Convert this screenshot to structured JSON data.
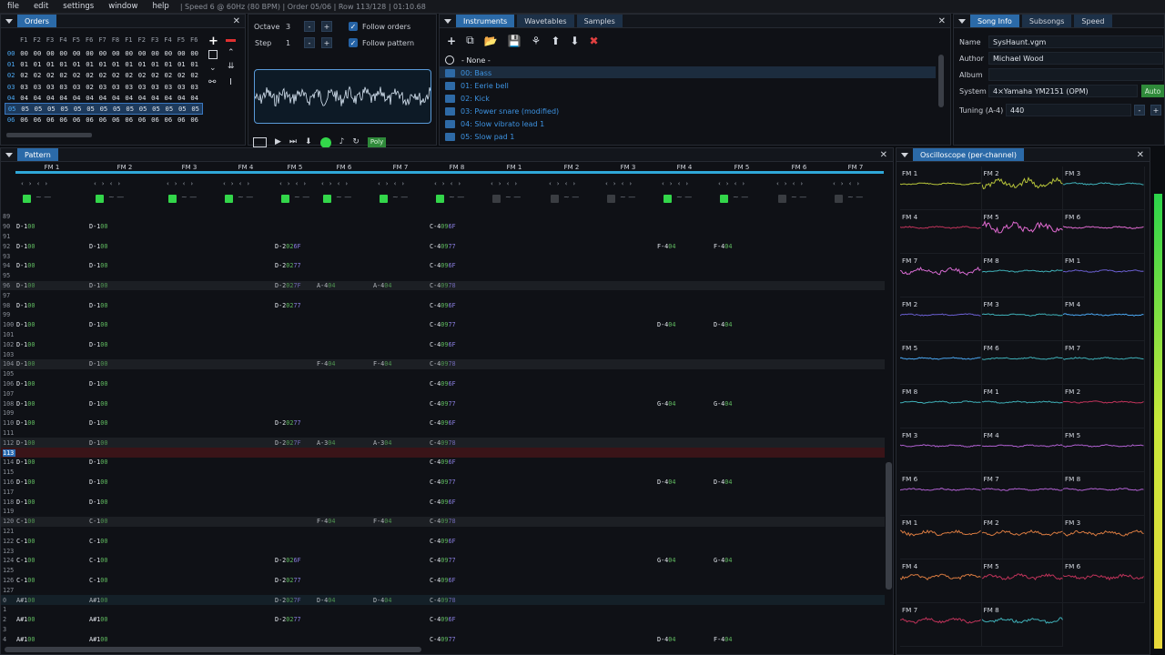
{
  "menubar": {
    "items": [
      "file",
      "edit",
      "settings",
      "window",
      "help"
    ],
    "status": "| Speed 6 @ 60Hz (80 BPM) | Order 05/06 | Row 113/128 | 01:10.68"
  },
  "orders": {
    "tab": "Orders",
    "headers": [
      "F1",
      "F2",
      "F3",
      "F4",
      "F5",
      "F6",
      "F7",
      "F8",
      "F1",
      "F2",
      "F3",
      "F4",
      "F5",
      "F6"
    ],
    "rows": [
      [
        "00",
        "00",
        "00",
        "00",
        "00",
        "00",
        "00",
        "00",
        "00",
        "00",
        "00",
        "00",
        "00",
        "00",
        "00"
      ],
      [
        "01",
        "01",
        "01",
        "01",
        "01",
        "01",
        "01",
        "01",
        "01",
        "01",
        "01",
        "01",
        "01",
        "01",
        "01"
      ],
      [
        "02",
        "02",
        "02",
        "02",
        "02",
        "02",
        "02",
        "02",
        "02",
        "02",
        "02",
        "02",
        "02",
        "02",
        "02"
      ],
      [
        "03",
        "03",
        "03",
        "03",
        "03",
        "03",
        "02",
        "03",
        "03",
        "03",
        "03",
        "03",
        "03",
        "03",
        "03"
      ],
      [
        "04",
        "04",
        "04",
        "04",
        "04",
        "04",
        "04",
        "04",
        "04",
        "04",
        "04",
        "04",
        "04",
        "04",
        "04"
      ],
      [
        "05",
        "05",
        "05",
        "05",
        "05",
        "05",
        "05",
        "05",
        "05",
        "05",
        "05",
        "05",
        "05",
        "05",
        "05"
      ],
      [
        "06",
        "06",
        "06",
        "06",
        "06",
        "06",
        "06",
        "06",
        "06",
        "06",
        "06",
        "06",
        "06",
        "06",
        "06"
      ]
    ]
  },
  "controls": {
    "octave_label": "Octave",
    "octave": "3",
    "step_label": "Step",
    "step": "1",
    "follow_orders": "Follow orders",
    "follow_pattern": "Follow pattern",
    "poly": "Poly",
    "minus": "-",
    "plus": "+"
  },
  "instruments": {
    "tabs": [
      "Instruments",
      "Wavetables",
      "Samples"
    ],
    "none": "- None -",
    "items": [
      "00: Bass",
      "01: Eerie bell",
      "02: Kick",
      "03: Power snare (modified)",
      "04: Slow vibrato lead 1",
      "05: Slow pad 1"
    ]
  },
  "song": {
    "tabs": [
      "Song Info",
      "Subsongs",
      "Speed"
    ],
    "name_label": "Name",
    "name": "SysHaunt.vgm",
    "author_label": "Author",
    "author": "Michael Wood",
    "album_label": "Album",
    "album": "",
    "system_label": "System",
    "system": "4×Yamaha YM2151 (OPM)",
    "auto": "Auto",
    "tuning_label": "Tuning (A-4)",
    "tuning": "440",
    "minus": "-",
    "plus": "+"
  },
  "pattern": {
    "tab": "Pattern",
    "channels": [
      "FM 1",
      "FM 2",
      "FM 3",
      "FM 4",
      "FM 5",
      "FM 6",
      "FM 7",
      "FM 8",
      "FM 1",
      "FM 2",
      "FM 3",
      "FM 4",
      "FM 5",
      "FM 6",
      "FM 7"
    ],
    "rows": [
      {
        "n": "89",
        "c": []
      },
      {
        "n": "90",
        "c": [
          [
            "D-1",
            "00",
            ""
          ],
          [
            "D-1",
            "00",
            ""
          ],
          null,
          null,
          null,
          null,
          null,
          [
            "C-4",
            "09",
            "6F"
          ]
        ]
      },
      {
        "n": "91",
        "c": []
      },
      {
        "n": "92",
        "c": [
          [
            "D-1",
            "00",
            ""
          ],
          [
            "D-1",
            "00",
            ""
          ],
          null,
          null,
          [
            "D-2",
            "02",
            "6F"
          ],
          null,
          null,
          [
            "C-4",
            "09",
            "77"
          ],
          null,
          null,
          null,
          [
            "F-4",
            "04",
            ""
          ],
          [
            "F-4",
            "04",
            ""
          ]
        ]
      },
      {
        "n": "93",
        "c": []
      },
      {
        "n": "94",
        "c": [
          [
            "D-1",
            "00",
            ""
          ],
          [
            "D-1",
            "00",
            ""
          ],
          null,
          null,
          [
            "D-2",
            "02",
            "77"
          ],
          null,
          null,
          [
            "C-4",
            "09",
            "6F"
          ]
        ]
      },
      {
        "n": "95",
        "c": []
      },
      {
        "n": "96",
        "c": [
          [
            "D-1",
            "00",
            ""
          ],
          [
            "D-1",
            "00",
            ""
          ],
          null,
          null,
          [
            "D-2",
            "02",
            "7F"
          ],
          [
            "A-4",
            "04",
            ""
          ],
          [
            "A-4",
            "04",
            ""
          ],
          [
            "C-4",
            "09",
            "78"
          ]
        ],
        "hl": 1
      },
      {
        "n": "97",
        "c": []
      },
      {
        "n": "98",
        "c": [
          [
            "D-1",
            "00",
            ""
          ],
          [
            "D-1",
            "00",
            ""
          ],
          null,
          null,
          [
            "D-2",
            "02",
            "77"
          ],
          null,
          null,
          [
            "C-4",
            "09",
            "6F"
          ]
        ]
      },
      {
        "n": "99",
        "c": []
      },
      {
        "n": "100",
        "c": [
          [
            "D-1",
            "00",
            ""
          ],
          [
            "D-1",
            "00",
            ""
          ],
          null,
          null,
          null,
          null,
          null,
          [
            "C-4",
            "09",
            "77"
          ],
          null,
          null,
          null,
          [
            "D-4",
            "04",
            ""
          ],
          [
            "D-4",
            "04",
            ""
          ]
        ]
      },
      {
        "n": "101",
        "c": []
      },
      {
        "n": "102",
        "c": [
          [
            "D-1",
            "00",
            ""
          ],
          [
            "D-1",
            "00",
            ""
          ],
          null,
          null,
          null,
          null,
          null,
          [
            "C-4",
            "09",
            "6F"
          ]
        ]
      },
      {
        "n": "103",
        "c": []
      },
      {
        "n": "104",
        "c": [
          [
            "D-1",
            "00",
            ""
          ],
          [
            "D-1",
            "00",
            ""
          ],
          null,
          null,
          null,
          [
            "F-4",
            "04",
            ""
          ],
          [
            "F-4",
            "04",
            ""
          ],
          [
            "C-4",
            "09",
            "78"
          ]
        ],
        "hl": 1
      },
      {
        "n": "105",
        "c": []
      },
      {
        "n": "106",
        "c": [
          [
            "D-1",
            "00",
            ""
          ],
          [
            "D-1",
            "00",
            ""
          ],
          null,
          null,
          null,
          null,
          null,
          [
            "C-4",
            "09",
            "6F"
          ]
        ]
      },
      {
        "n": "107",
        "c": []
      },
      {
        "n": "108",
        "c": [
          [
            "D-1",
            "00",
            ""
          ],
          [
            "D-1",
            "00",
            ""
          ],
          null,
          null,
          null,
          null,
          null,
          [
            "C-4",
            "09",
            "77"
          ],
          null,
          null,
          null,
          [
            "G-4",
            "04",
            ""
          ],
          [
            "G-4",
            "04",
            ""
          ]
        ]
      },
      {
        "n": "109",
        "c": []
      },
      {
        "n": "110",
        "c": [
          [
            "D-1",
            "00",
            ""
          ],
          [
            "D-1",
            "00",
            ""
          ],
          null,
          null,
          [
            "D-2",
            "02",
            "77"
          ],
          null,
          null,
          [
            "C-4",
            "09",
            "6F"
          ]
        ]
      },
      {
        "n": "111",
        "c": []
      },
      {
        "n": "112",
        "c": [
          [
            "D-1",
            "00",
            ""
          ],
          [
            "D-1",
            "00",
            ""
          ],
          null,
          null,
          [
            "D-2",
            "02",
            "7F"
          ],
          [
            "A-3",
            "04",
            ""
          ],
          [
            "A-3",
            "04",
            ""
          ],
          [
            "C-4",
            "09",
            "78"
          ]
        ],
        "hl": 1
      },
      {
        "n": "113",
        "c": [],
        "cur": 1
      },
      {
        "n": "114",
        "c": [
          [
            "D-1",
            "00",
            ""
          ],
          [
            "D-1",
            "00",
            ""
          ],
          null,
          null,
          null,
          null,
          null,
          [
            "C-4",
            "09",
            "6F"
          ]
        ]
      },
      {
        "n": "115",
        "c": []
      },
      {
        "n": "116",
        "c": [
          [
            "D-1",
            "00",
            ""
          ],
          [
            "D-1",
            "00",
            ""
          ],
          null,
          null,
          null,
          null,
          null,
          [
            "C-4",
            "09",
            "77"
          ],
          null,
          null,
          null,
          [
            "D-4",
            "04",
            ""
          ],
          [
            "D-4",
            "04",
            ""
          ]
        ]
      },
      {
        "n": "117",
        "c": []
      },
      {
        "n": "118",
        "c": [
          [
            "D-1",
            "00",
            ""
          ],
          [
            "D-1",
            "00",
            ""
          ],
          null,
          null,
          null,
          null,
          null,
          [
            "C-4",
            "09",
            "6F"
          ]
        ]
      },
      {
        "n": "119",
        "c": []
      },
      {
        "n": "120",
        "c": [
          [
            "C-1",
            "00",
            ""
          ],
          [
            "C-1",
            "00",
            ""
          ],
          null,
          null,
          null,
          [
            "F-4",
            "04",
            ""
          ],
          [
            "F-4",
            "04",
            ""
          ],
          [
            "C-4",
            "09",
            "78"
          ]
        ],
        "hl": 1
      },
      {
        "n": "121",
        "c": []
      },
      {
        "n": "122",
        "c": [
          [
            "C-1",
            "00",
            ""
          ],
          [
            "C-1",
            "00",
            ""
          ],
          null,
          null,
          null,
          null,
          null,
          [
            "C-4",
            "09",
            "6F"
          ]
        ]
      },
      {
        "n": "123",
        "c": []
      },
      {
        "n": "124",
        "c": [
          [
            "C-1",
            "00",
            ""
          ],
          [
            "C-1",
            "00",
            ""
          ],
          null,
          null,
          [
            "D-2",
            "02",
            "6F"
          ],
          null,
          null,
          [
            "C-4",
            "09",
            "77"
          ],
          null,
          null,
          null,
          [
            "G-4",
            "04",
            ""
          ],
          [
            "G-4",
            "04",
            ""
          ]
        ]
      },
      {
        "n": "125",
        "c": []
      },
      {
        "n": "126",
        "c": [
          [
            "C-1",
            "00",
            ""
          ],
          [
            "C-1",
            "00",
            ""
          ],
          null,
          null,
          [
            "D-2",
            "02",
            "77"
          ],
          null,
          null,
          [
            "C-4",
            "09",
            "6F"
          ]
        ]
      },
      {
        "n": "127",
        "c": []
      },
      {
        "n": "0",
        "c": [
          [
            "A#1",
            "00",
            ""
          ],
          [
            "A#1",
            "00",
            ""
          ],
          null,
          null,
          [
            "D-2",
            "02",
            "7F"
          ],
          [
            "D-4",
            "04",
            ""
          ],
          [
            "D-4",
            "04",
            ""
          ],
          [
            "C-4",
            "09",
            "78"
          ]
        ],
        "hl": 2
      },
      {
        "n": "1",
        "c": []
      },
      {
        "n": "2",
        "c": [
          [
            "A#1",
            "00",
            ""
          ],
          [
            "A#1",
            "00",
            ""
          ],
          null,
          null,
          [
            "D-2",
            "02",
            "77"
          ],
          null,
          null,
          [
            "C-4",
            "09",
            "6F"
          ]
        ]
      },
      {
        "n": "3",
        "c": []
      },
      {
        "n": "4",
        "c": [
          [
            "A#1",
            "00",
            ""
          ],
          [
            "A#1",
            "00",
            ""
          ],
          null,
          null,
          null,
          null,
          null,
          [
            "C-4",
            "09",
            "77"
          ],
          null,
          null,
          null,
          [
            "D-4",
            "04",
            ""
          ],
          [
            "F-4",
            "04",
            ""
          ]
        ]
      }
    ]
  },
  "osc": {
    "tab": "Oscilloscope (per-channel)",
    "labels": [
      "FM 1",
      "FM 2",
      "FM 3",
      "FM 4",
      "FM 5",
      "FM 6",
      "FM 7",
      "FM 8",
      "FM 1",
      "FM 2",
      "FM 3",
      "FM 4",
      "FM 5",
      "FM 6",
      "FM 7",
      "FM 8",
      "FM 1",
      "FM 2",
      "FM 3",
      "FM 4",
      "FM 5",
      "FM 6",
      "FM 7",
      "FM 8",
      "FM 1",
      "FM 2",
      "FM 3",
      "FM 4",
      "FM 5",
      "FM 6",
      "FM 7",
      "FM 8"
    ],
    "colors": [
      "#b7c43a",
      "#b7c43a",
      "#3fb0b8",
      "#c0335a",
      "#e06ad0",
      "#e06ad0",
      "#d66ad0",
      "#3fb0b8",
      "#6a5fd0",
      "#6a5fd0",
      "#3fb0b8",
      "#4aa6f0",
      "#4aa6f0",
      "#3fb0b8",
      "#3fb0b8",
      "#3fb0b8",
      "#3fb0b8",
      "#c0335a",
      "#b060d0",
      "#b060d0",
      "#b060d0",
      "#b060d0",
      "#b060d0",
      "#b060d0",
      "#d87a40",
      "#d87a40",
      "#d87a40",
      "#d87a40",
      "#c0335a",
      "#c0335a",
      "#c0335a",
      "#3fb0b8"
    ]
  }
}
